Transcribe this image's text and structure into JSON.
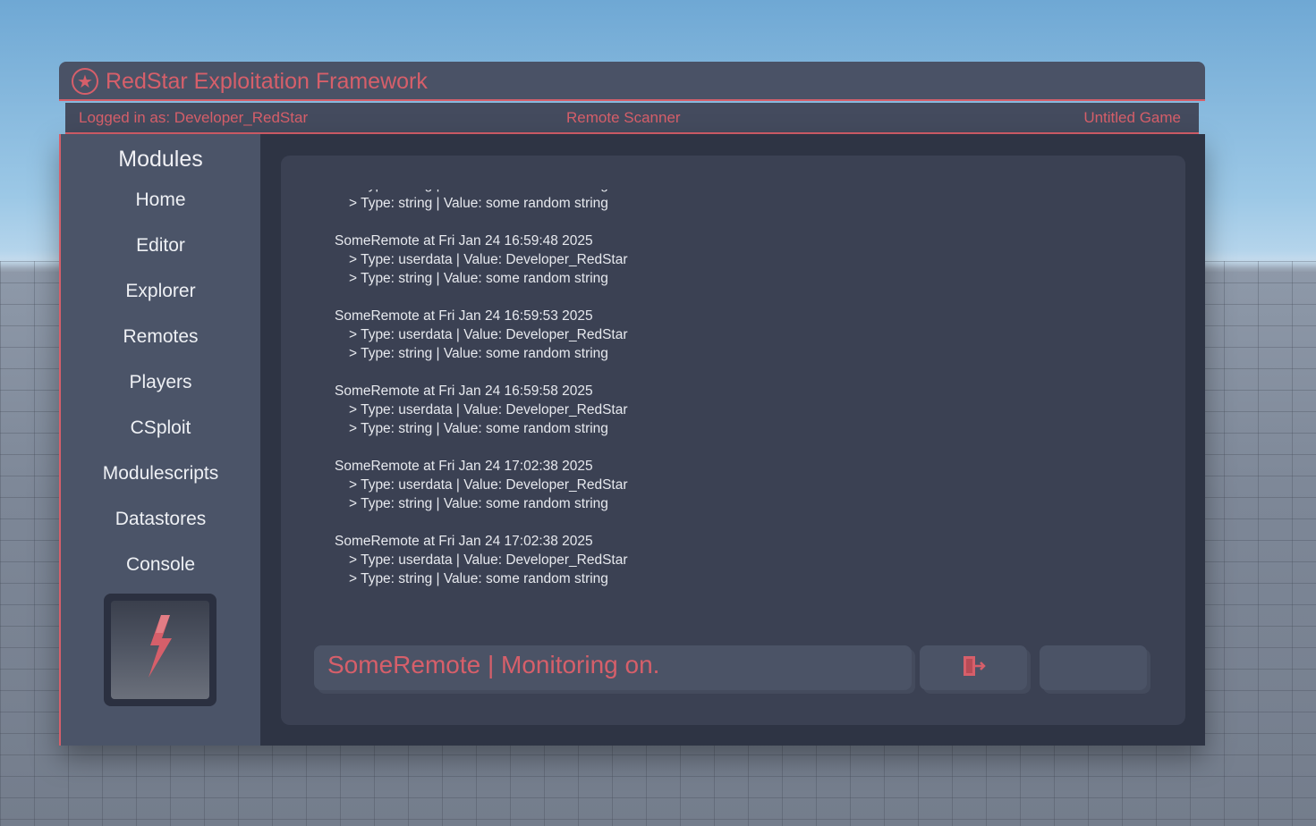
{
  "window": {
    "title": "RedStar Exploitation Framework",
    "logo_icon": "star-circle-icon"
  },
  "infobar": {
    "user": "Logged in as: Developer_RedStar",
    "module": "Remote Scanner",
    "game": "Untitled Game"
  },
  "sidebar": {
    "title": "Modules",
    "items": [
      {
        "label": "Home"
      },
      {
        "label": "Editor"
      },
      {
        "label": "Explorer"
      },
      {
        "label": "Remotes"
      },
      {
        "label": "Players"
      },
      {
        "label": "CSploit"
      },
      {
        "label": "Modulescripts"
      },
      {
        "label": "Datastores"
      },
      {
        "label": "Console"
      }
    ],
    "image_icon": "red-lightning-bolt-icon"
  },
  "log": {
    "partial_line": "> Type: string | Value: some random string",
    "entries": [
      {
        "header": "SomeRemote at Fri Jan 24 16:59:48 2025",
        "lines": [
          "> Type: userdata | Value: Developer_RedStar",
          "> Type: string | Value: some random string"
        ]
      },
      {
        "header": "SomeRemote at Fri Jan 24 16:59:53 2025",
        "lines": [
          "> Type: userdata | Value: Developer_RedStar",
          "> Type: string | Value: some random string"
        ]
      },
      {
        "header": "SomeRemote at Fri Jan 24 16:59:58 2025",
        "lines": [
          "> Type: userdata | Value: Developer_RedStar",
          "> Type: string | Value: some random string"
        ]
      },
      {
        "header": "SomeRemote at Fri Jan 24 17:02:38 2025",
        "lines": [
          "> Type: userdata | Value: Developer_RedStar",
          "> Type: string | Value: some random string"
        ]
      },
      {
        "header": "SomeRemote at Fri Jan 24 17:02:38 2025",
        "lines": [
          "> Type: userdata | Value: Developer_RedStar",
          "> Type: string | Value: some random string"
        ]
      }
    ]
  },
  "status": {
    "text": "SomeRemote | Monitoring on."
  },
  "buttons": {
    "exit_icon": "exit-door-icon",
    "blank_label": ""
  },
  "colors": {
    "accent": "#d65f6a",
    "panel": "#3b4153",
    "sidebar": "#4b5468"
  }
}
